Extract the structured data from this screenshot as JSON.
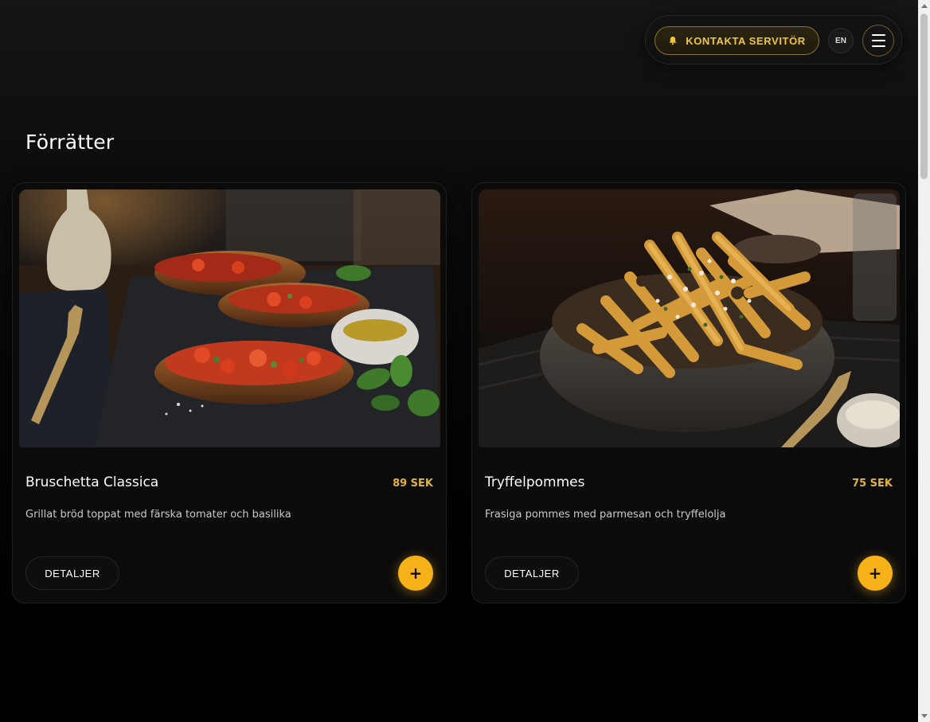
{
  "header": {
    "waiter_button_label": "KONTAKTA SERVITÖR",
    "waiter_icon": "bell-icon",
    "language_label": "EN",
    "menu_icon": "hamburger-menu-icon"
  },
  "section": {
    "title": "Förrätter"
  },
  "items": [
    {
      "name": "Bruschetta Classica",
      "price": "89 SEK",
      "description": "Grillat bröd toppat med färska tomater och basilika",
      "details_label": "DETALJER",
      "add_label": "+"
    },
    {
      "name": "Tryffelpommes",
      "price": "75 SEK",
      "description": "Frasiga pommes med parmesan och tryffelolja",
      "details_label": "DETALJER",
      "add_label": "+"
    }
  ],
  "colors": {
    "accent": "#f7b21a",
    "price": "#e2b53a",
    "waiter_text": "#f3c43b",
    "background": "#000000"
  }
}
